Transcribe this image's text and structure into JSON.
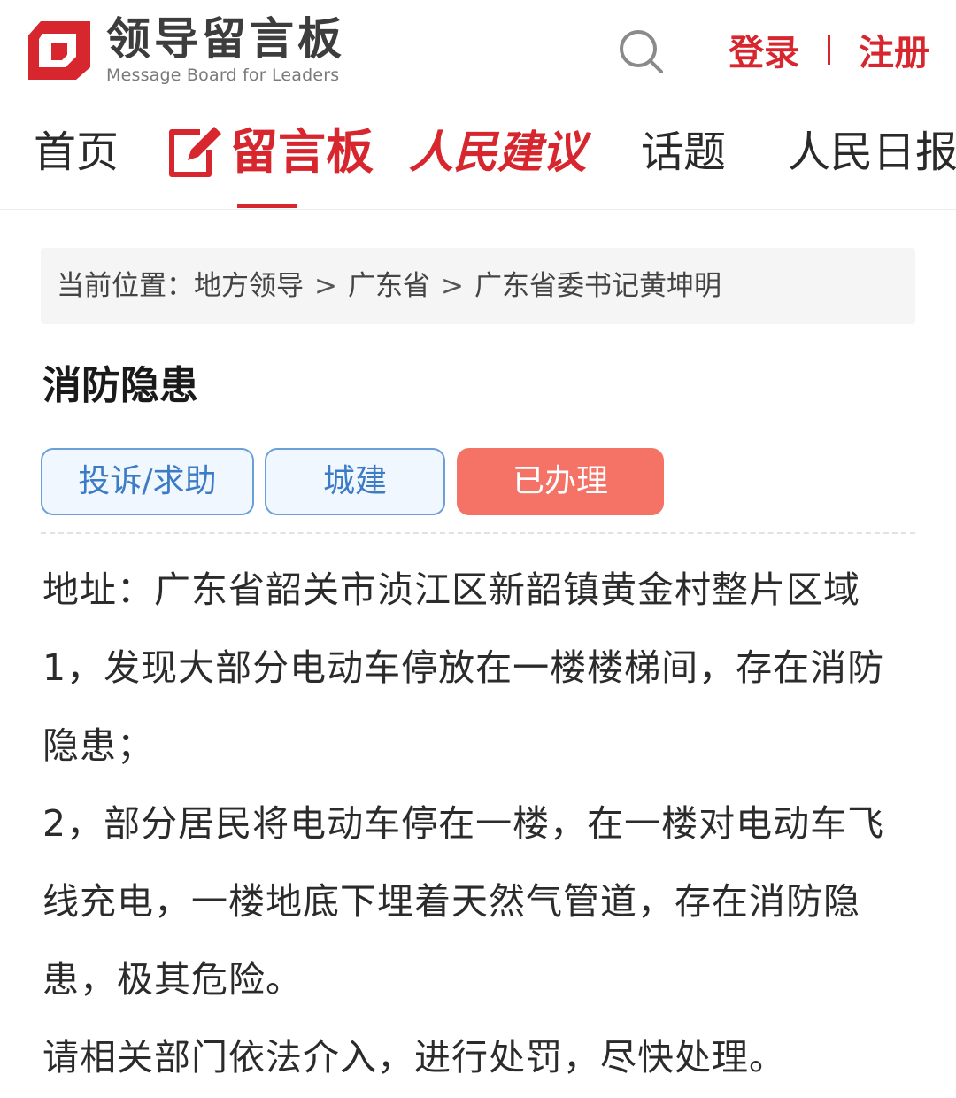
{
  "header": {
    "logo_title": "领导留言板",
    "logo_subtitle": "Message Board for Leaders",
    "search_icon": "search-icon",
    "login_label": "登录",
    "register_label": "注册",
    "brand_color": "#d8262e"
  },
  "nav": {
    "items": [
      {
        "label": "首页"
      },
      {
        "label": "留言板",
        "active": true
      },
      {
        "label": "人民建议"
      },
      {
        "label": "话题"
      },
      {
        "label": "人民日报"
      }
    ]
  },
  "breadcrumb": {
    "prefix": "当前位置：",
    "items": [
      "地方领导",
      "广东省",
      "广东省委书记黄坤明"
    ],
    "separator": ">"
  },
  "post": {
    "title": "消防隐患",
    "tags": [
      "投诉/求助",
      "城建"
    ],
    "status": "已办理",
    "status_color": "#f47366",
    "lines": [
      "地址：广东省韶关市浈江区新韶镇黄金村整片区域",
      "1，发现大部分电动车停放在一楼楼梯间，存在消防隐患；",
      "2，部分居民将电动车停在一楼，在一楼对电动车飞线充电，一楼地底下埋着天然气管道，存在消防隐患，极其危险。",
      "请相关部门依法介入，进行处罚，尽快处理。"
    ]
  }
}
